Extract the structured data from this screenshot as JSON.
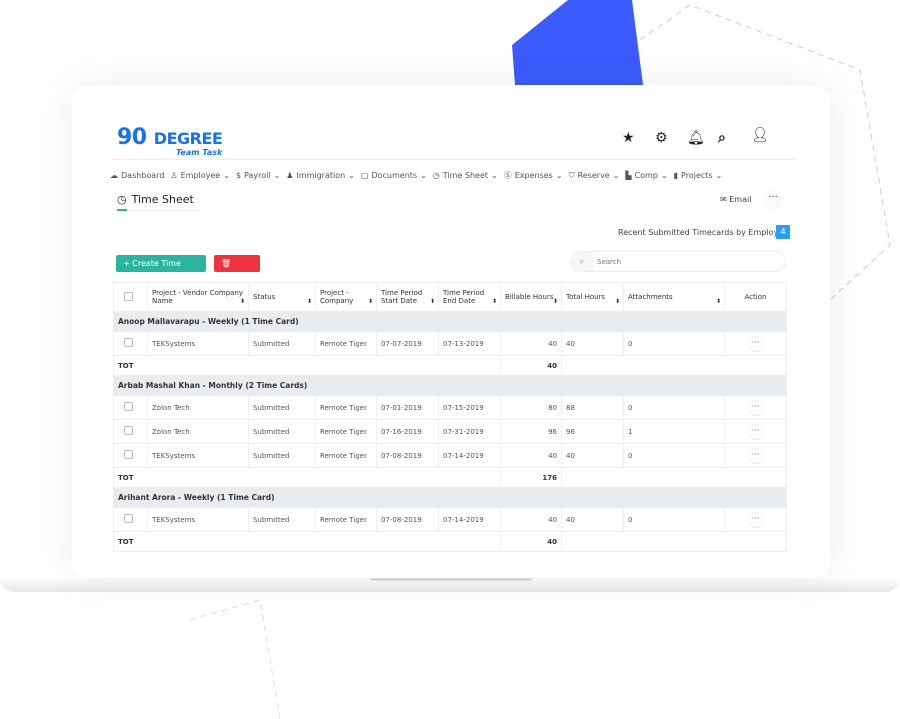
{
  "colors": {
    "accent": "#2bb5a0",
    "danger": "#f0323e",
    "brand": "#1a73e8",
    "badge": "#2a9df4",
    "decor": "#3b5bfd"
  },
  "logo": {
    "big": "90",
    "word": "DEGREE",
    "sub": "Team Task"
  },
  "header_icons": [
    "star-icon",
    "gear-icon",
    "bell-icon",
    "search-icon",
    "user-icon"
  ],
  "nav": [
    {
      "label": "Dashboard",
      "icon": "cloud-icon"
    },
    {
      "label": "Employee",
      "icon": "user-icon"
    },
    {
      "label": "Payroll",
      "icon": "dollar-icon"
    },
    {
      "label": "Immigration",
      "icon": "stamp-icon"
    },
    {
      "label": "Documents",
      "icon": "folder-icon"
    },
    {
      "label": "Time Sheet",
      "icon": "clock-icon"
    },
    {
      "label": "Expenses",
      "icon": "coin-icon"
    },
    {
      "label": "Reserve",
      "icon": "shield-icon"
    },
    {
      "label": "Comp",
      "icon": "chart-icon"
    },
    {
      "label": "Projects",
      "icon": "clipboard-icon"
    }
  ],
  "page": {
    "title": "Time Sheet",
    "email": "Email",
    "recent": "Recent Submitted Timecards by Employee",
    "recent_count": "4",
    "create": "+ Create Time Sheet",
    "delete": "Delete",
    "search_placeholder": "Search"
  },
  "columns": [
    "Project - Vendor Company Name",
    "Status",
    "Project - Company",
    "Time Period Start Date",
    "Time Period End Date",
    "Billable Hours",
    "Total Hours",
    "Attachments",
    "Action"
  ],
  "groups": [
    {
      "title": "Anoop Mallavarapu - Weekly (1 Time Card)",
      "total": "40",
      "rows": [
        [
          "TEKSystems",
          "Submitted",
          "Remote Tiger",
          "07-07-2019",
          "07-13-2019",
          "40",
          "40",
          "0"
        ]
      ]
    },
    {
      "title": "Arbab Mashal Khan - Monthly (2 Time Cards)",
      "total": "176",
      "rows": [
        [
          "Zolon Tech",
          "Submitted",
          "Remote Tiger",
          "07-01-2019",
          "07-15-2019",
          "80",
          "88",
          "0"
        ],
        [
          "Zolon Tech",
          "Submitted",
          "Remote Tiger",
          "07-16-2019",
          "07-31-2019",
          "96",
          "96",
          "1"
        ],
        [
          "TEKSystems",
          "Submitted",
          "Remote Tiger",
          "07-08-2019",
          "07-14-2019",
          "40",
          "40",
          "0"
        ]
      ]
    },
    {
      "title": "Arihant Arora - Weekly (1 Time Card)",
      "total": "40",
      "rows": [
        [
          "TEKSystems",
          "Submitted",
          "Remote Tiger",
          "07-08-2019",
          "07-14-2019",
          "40",
          "40",
          "0"
        ]
      ]
    }
  ],
  "tot_label": "TOT"
}
